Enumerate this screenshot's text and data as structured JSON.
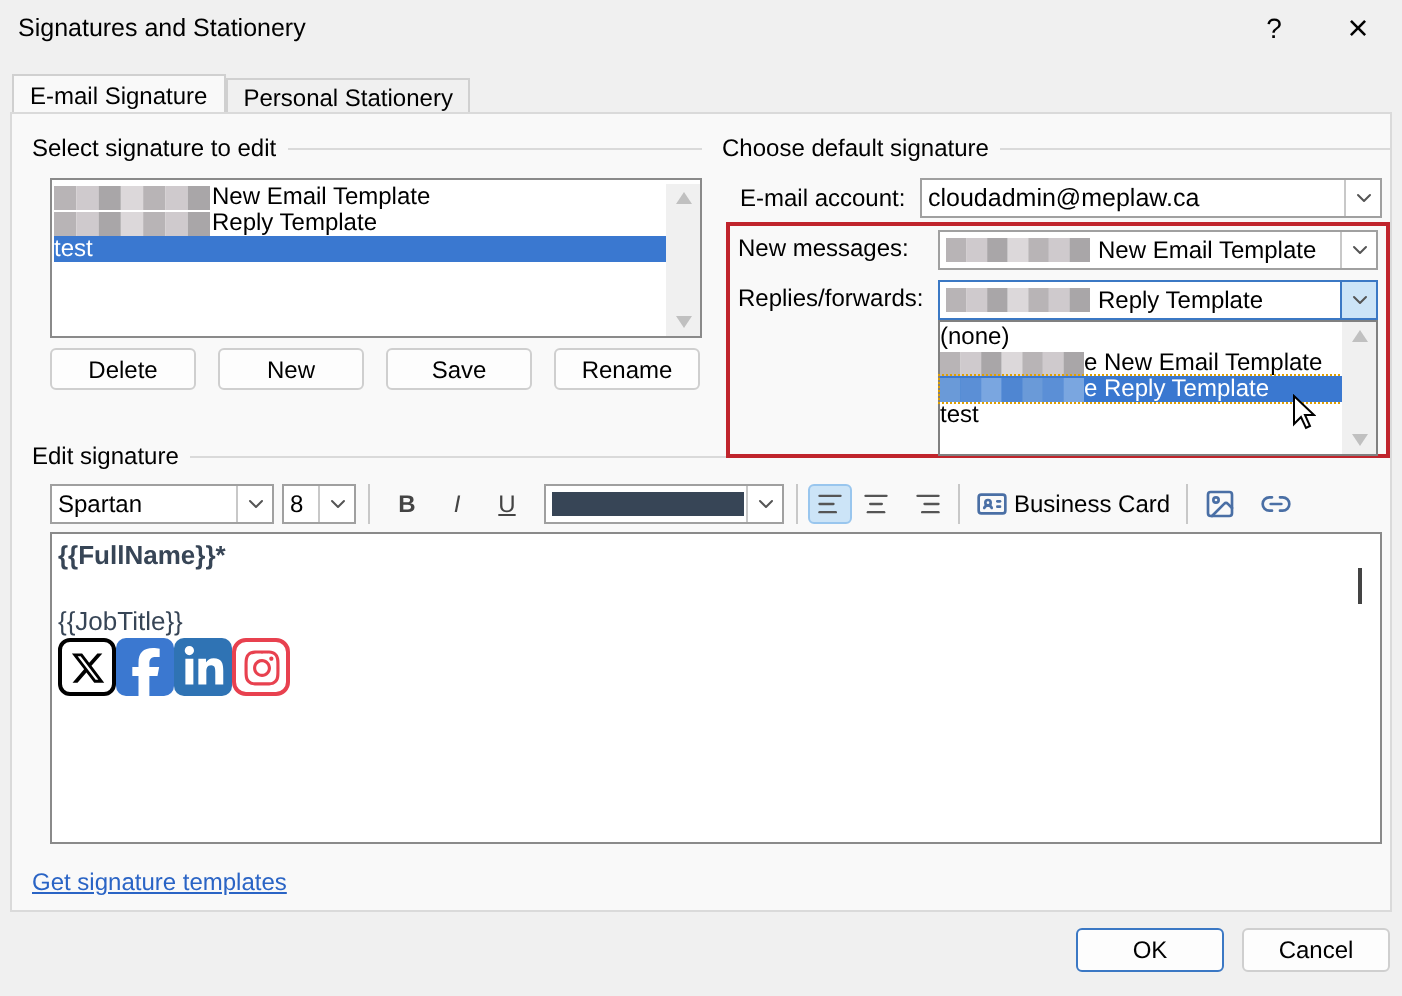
{
  "window": {
    "title": "Signatures and Stationery",
    "help": "?",
    "close": "×"
  },
  "tabs": [
    {
      "label": "E-mail Signature",
      "selected": true
    },
    {
      "label": "Personal Stationery",
      "selected": false
    }
  ],
  "select_signature": {
    "heading": "Select signature to edit",
    "items": [
      {
        "label": "New Email Template",
        "redacted": true,
        "selected": false
      },
      {
        "label": "Reply Template",
        "redacted": true,
        "selected": false
      },
      {
        "label": "test",
        "redacted": false,
        "selected": true
      }
    ],
    "buttons": [
      "Delete",
      "New",
      "Save",
      "Rename"
    ]
  },
  "default_signature": {
    "heading": "Choose default signature",
    "account": {
      "label": "E-mail account:",
      "value": "cloudadmin@meplaw.ca"
    },
    "new_messages": {
      "label": "New messages:",
      "value": "New Email Template",
      "redacted": true
    },
    "replies": {
      "label": "Replies/forwards:",
      "value": "Reply Template",
      "redacted": true,
      "expanded": true,
      "options": [
        {
          "label": "(none)",
          "redacted": false,
          "selected": false
        },
        {
          "label": "e New Email Template",
          "redacted": true,
          "selected": false
        },
        {
          "label": "e Reply Template",
          "redacted": true,
          "selected": true
        },
        {
          "label": "test",
          "redacted": false,
          "selected": false
        }
      ]
    }
  },
  "edit_signature": {
    "heading": "Edit signature",
    "font": "Spartan",
    "size": "8",
    "format_buttons": [
      "B",
      "I",
      "U"
    ],
    "business_card": "Business Card",
    "content": [
      {
        "kind": "name",
        "text": "{{FullName}}*"
      },
      {
        "kind": "blank"
      },
      {
        "kind": "title",
        "text": "{{JobTitle}}"
      },
      {
        "kind": "social"
      }
    ]
  },
  "link": "Get signature templates",
  "footer": {
    "ok": "OK",
    "cancel": "Cancel"
  }
}
